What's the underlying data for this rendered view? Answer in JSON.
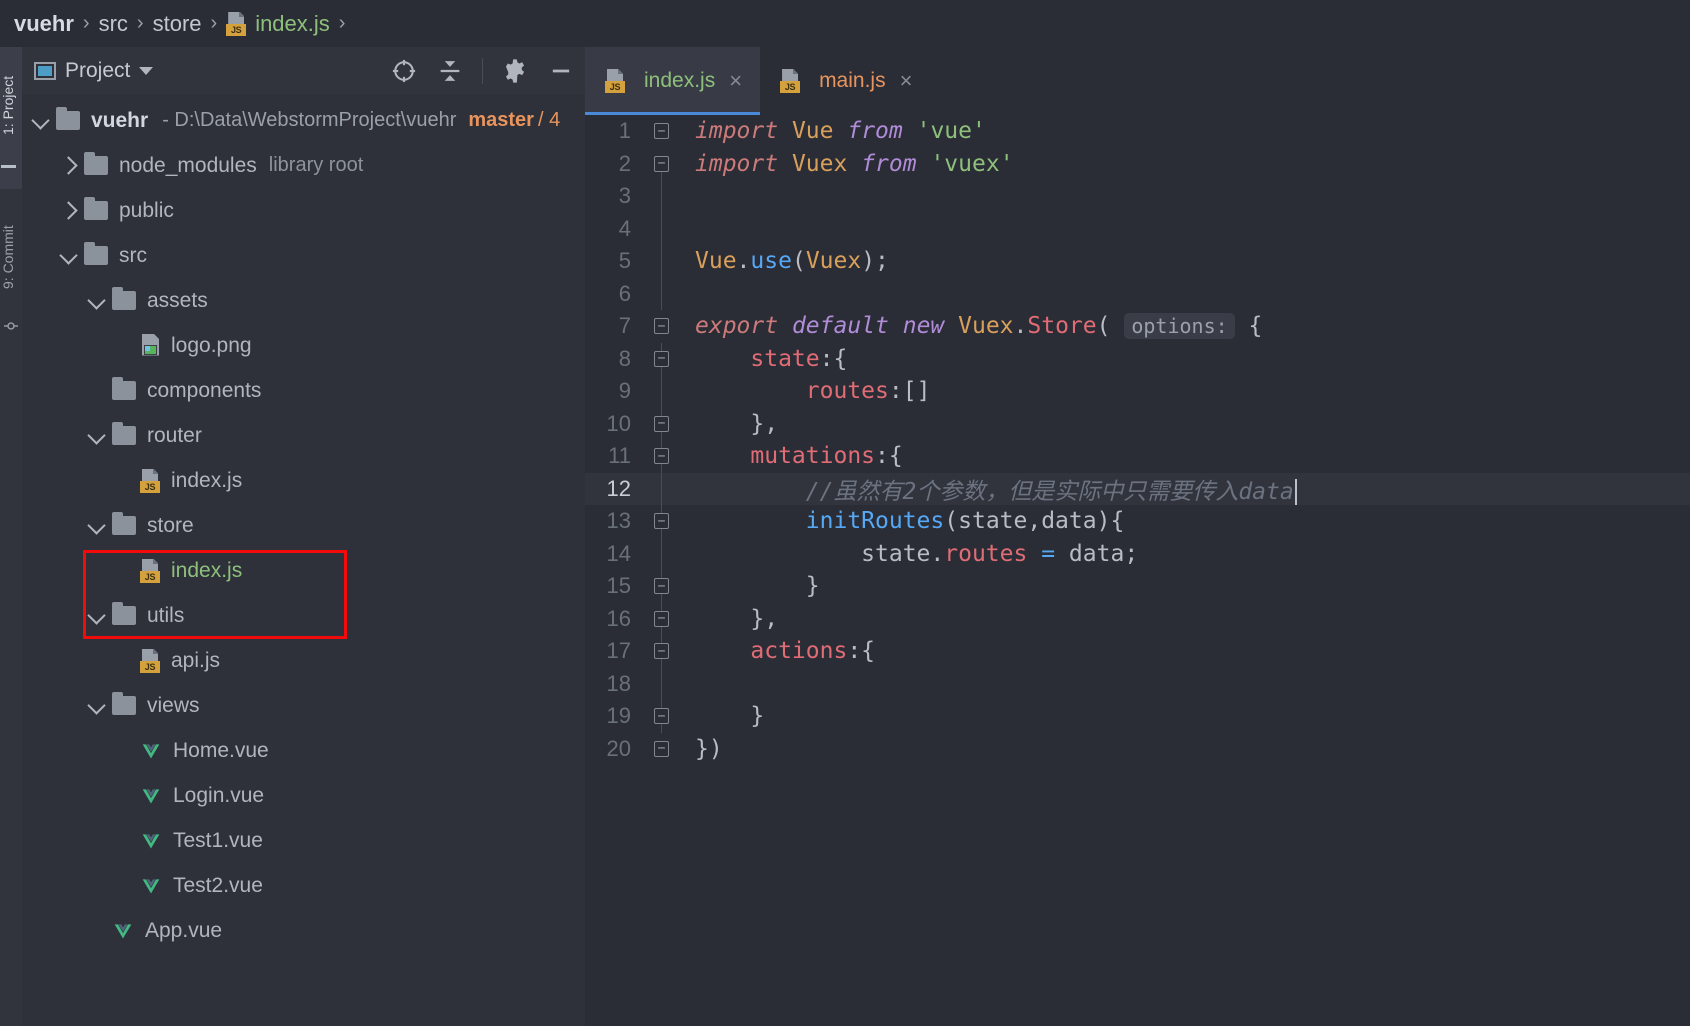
{
  "breadcrumb": {
    "items": [
      {
        "label": "vuehr",
        "style": "bold"
      },
      {
        "label": "src",
        "style": "normal"
      },
      {
        "label": "store",
        "style": "normal"
      },
      {
        "label": "index.js",
        "style": "green",
        "icon": "js-file-icon"
      }
    ],
    "separator": "›"
  },
  "toolstrip": {
    "project_label": "1: Project",
    "commit_label": "9: Commit"
  },
  "project_panel": {
    "title": "Project",
    "icons": {
      "project": "project-window-icon",
      "dropdown": "chevron-down-icon",
      "locate": "select-opened-file-icon",
      "collapse": "collapse-all-icon",
      "settings": "gear-icon",
      "hide": "hide-panel-icon"
    },
    "root": {
      "name": "vuehr",
      "path": "- D:\\Data\\WebstormProject\\vuehr",
      "branch": "master",
      "branch_suffix": "/ 4"
    },
    "tree": [
      {
        "label": "node_modules",
        "suffix": "library root",
        "type": "folder",
        "state": "closed",
        "indent": 1
      },
      {
        "label": "public",
        "suffix": "",
        "type": "folder",
        "state": "closed",
        "indent": 1
      },
      {
        "label": "src",
        "suffix": "",
        "type": "folder",
        "state": "open",
        "indent": 1
      },
      {
        "label": "assets",
        "suffix": "",
        "type": "folder",
        "state": "open",
        "indent": 2
      },
      {
        "label": "logo.png",
        "suffix": "",
        "type": "png",
        "state": "leaf",
        "indent": 3
      },
      {
        "label": "components",
        "suffix": "",
        "type": "folder",
        "state": "leaf",
        "indent": 2
      },
      {
        "label": "router",
        "suffix": "",
        "type": "folder",
        "state": "open",
        "indent": 2
      },
      {
        "label": "index.js",
        "suffix": "",
        "type": "js",
        "state": "leaf",
        "indent": 3
      },
      {
        "label": "store",
        "suffix": "",
        "type": "folder",
        "state": "open",
        "indent": 2
      },
      {
        "label": "index.js",
        "suffix": "",
        "type": "js",
        "state": "leaf",
        "indent": 3,
        "color": "green"
      },
      {
        "label": "utils",
        "suffix": "",
        "type": "folder",
        "state": "open",
        "indent": 2
      },
      {
        "label": "api.js",
        "suffix": "",
        "type": "js",
        "state": "leaf",
        "indent": 3
      },
      {
        "label": "views",
        "suffix": "",
        "type": "folder",
        "state": "open",
        "indent": 2
      },
      {
        "label": "Home.vue",
        "suffix": "",
        "type": "vue",
        "state": "leaf",
        "indent": 3
      },
      {
        "label": "Login.vue",
        "suffix": "",
        "type": "vue",
        "state": "leaf",
        "indent": 3
      },
      {
        "label": "Test1.vue",
        "suffix": "",
        "type": "vue",
        "state": "leaf",
        "indent": 3
      },
      {
        "label": "Test2.vue",
        "suffix": "",
        "type": "vue",
        "state": "leaf",
        "indent": 3
      },
      {
        "label": "App.vue",
        "suffix": "",
        "type": "vue",
        "state": "leaf",
        "indent": 2
      }
    ],
    "annotation": {
      "shape": "rectangle",
      "color": "#f30b0b",
      "targets": [
        "store",
        "index.js"
      ]
    }
  },
  "editor": {
    "tabs": [
      {
        "label": "index.js",
        "color": "green",
        "active": true,
        "icon": "js-file-icon",
        "close": "×"
      },
      {
        "label": "main.js",
        "color": "orange",
        "active": false,
        "icon": "js-file-icon",
        "close": "×"
      }
    ],
    "current_line": 12,
    "file_content_lines": [
      "import Vue from 'vue'",
      "import Vuex from 'vuex'",
      "",
      "",
      "Vue.use(Vuex);",
      "",
      "export default new Vuex.Store( options: {",
      "    state:{",
      "        routes:[]",
      "    },",
      "    mutations:{",
      "        //虽然有2个参数，但是实际中只需要传入data",
      "        initRoutes(state,data){",
      "            state.routes = data;",
      "        }",
      "    },",
      "    actions:{",
      "",
      "    }",
      "})"
    ],
    "line_numbers": [
      1,
      2,
      3,
      4,
      5,
      6,
      7,
      8,
      9,
      10,
      11,
      12,
      13,
      14,
      15,
      16,
      17,
      18,
      19,
      20
    ],
    "inlay_hint": "options:",
    "comment_line_12": "//虽然有2个参数，但是实际中只需要传入data"
  },
  "colors": {
    "background": "#2b2d36",
    "panel": "#2e303a",
    "header": "#32343d",
    "active_tab": "#383b46",
    "accent_blue": "#4a88d8",
    "annotation_red": "#f30b0b",
    "string_green": "#8ec07c",
    "keyword_red": "#cc7a7a",
    "keyword_purple": "#b08cd8",
    "property_red": "#e06c75",
    "function_blue": "#56a8f5",
    "identifier_orange": "#d9a05b",
    "comment_gray": "#6b7280",
    "branch_orange": "#e8945c"
  }
}
